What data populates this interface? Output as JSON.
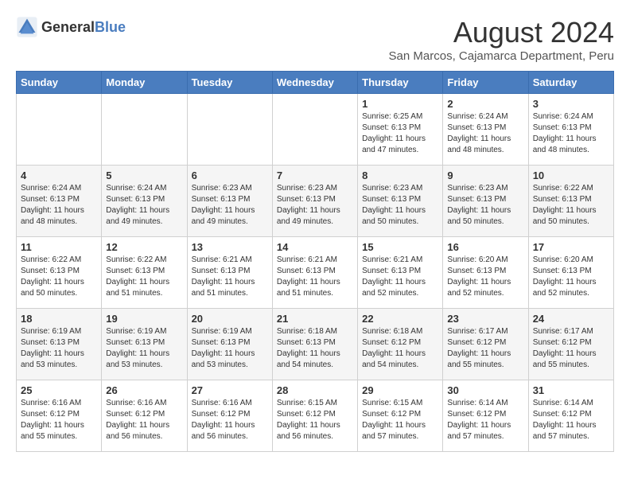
{
  "logo": {
    "general": "General",
    "blue": "Blue"
  },
  "title": "August 2024",
  "subtitle": "San Marcos, Cajamarca Department, Peru",
  "days_of_week": [
    "Sunday",
    "Monday",
    "Tuesday",
    "Wednesday",
    "Thursday",
    "Friday",
    "Saturday"
  ],
  "weeks": [
    [
      {
        "day": "",
        "content": ""
      },
      {
        "day": "",
        "content": ""
      },
      {
        "day": "",
        "content": ""
      },
      {
        "day": "",
        "content": ""
      },
      {
        "day": "1",
        "content": "Sunrise: 6:25 AM\nSunset: 6:13 PM\nDaylight: 11 hours and 47 minutes."
      },
      {
        "day": "2",
        "content": "Sunrise: 6:24 AM\nSunset: 6:13 PM\nDaylight: 11 hours and 48 minutes."
      },
      {
        "day": "3",
        "content": "Sunrise: 6:24 AM\nSunset: 6:13 PM\nDaylight: 11 hours and 48 minutes."
      }
    ],
    [
      {
        "day": "4",
        "content": "Sunrise: 6:24 AM\nSunset: 6:13 PM\nDaylight: 11 hours and 48 minutes."
      },
      {
        "day": "5",
        "content": "Sunrise: 6:24 AM\nSunset: 6:13 PM\nDaylight: 11 hours and 49 minutes."
      },
      {
        "day": "6",
        "content": "Sunrise: 6:23 AM\nSunset: 6:13 PM\nDaylight: 11 hours and 49 minutes."
      },
      {
        "day": "7",
        "content": "Sunrise: 6:23 AM\nSunset: 6:13 PM\nDaylight: 11 hours and 49 minutes."
      },
      {
        "day": "8",
        "content": "Sunrise: 6:23 AM\nSunset: 6:13 PM\nDaylight: 11 hours and 50 minutes."
      },
      {
        "day": "9",
        "content": "Sunrise: 6:23 AM\nSunset: 6:13 PM\nDaylight: 11 hours and 50 minutes."
      },
      {
        "day": "10",
        "content": "Sunrise: 6:22 AM\nSunset: 6:13 PM\nDaylight: 11 hours and 50 minutes."
      }
    ],
    [
      {
        "day": "11",
        "content": "Sunrise: 6:22 AM\nSunset: 6:13 PM\nDaylight: 11 hours and 50 minutes."
      },
      {
        "day": "12",
        "content": "Sunrise: 6:22 AM\nSunset: 6:13 PM\nDaylight: 11 hours and 51 minutes."
      },
      {
        "day": "13",
        "content": "Sunrise: 6:21 AM\nSunset: 6:13 PM\nDaylight: 11 hours and 51 minutes."
      },
      {
        "day": "14",
        "content": "Sunrise: 6:21 AM\nSunset: 6:13 PM\nDaylight: 11 hours and 51 minutes."
      },
      {
        "day": "15",
        "content": "Sunrise: 6:21 AM\nSunset: 6:13 PM\nDaylight: 11 hours and 52 minutes."
      },
      {
        "day": "16",
        "content": "Sunrise: 6:20 AM\nSunset: 6:13 PM\nDaylight: 11 hours and 52 minutes."
      },
      {
        "day": "17",
        "content": "Sunrise: 6:20 AM\nSunset: 6:13 PM\nDaylight: 11 hours and 52 minutes."
      }
    ],
    [
      {
        "day": "18",
        "content": "Sunrise: 6:19 AM\nSunset: 6:13 PM\nDaylight: 11 hours and 53 minutes."
      },
      {
        "day": "19",
        "content": "Sunrise: 6:19 AM\nSunset: 6:13 PM\nDaylight: 11 hours and 53 minutes."
      },
      {
        "day": "20",
        "content": "Sunrise: 6:19 AM\nSunset: 6:13 PM\nDaylight: 11 hours and 53 minutes."
      },
      {
        "day": "21",
        "content": "Sunrise: 6:18 AM\nSunset: 6:13 PM\nDaylight: 11 hours and 54 minutes."
      },
      {
        "day": "22",
        "content": "Sunrise: 6:18 AM\nSunset: 6:12 PM\nDaylight: 11 hours and 54 minutes."
      },
      {
        "day": "23",
        "content": "Sunrise: 6:17 AM\nSunset: 6:12 PM\nDaylight: 11 hours and 55 minutes."
      },
      {
        "day": "24",
        "content": "Sunrise: 6:17 AM\nSunset: 6:12 PM\nDaylight: 11 hours and 55 minutes."
      }
    ],
    [
      {
        "day": "25",
        "content": "Sunrise: 6:16 AM\nSunset: 6:12 PM\nDaylight: 11 hours and 55 minutes."
      },
      {
        "day": "26",
        "content": "Sunrise: 6:16 AM\nSunset: 6:12 PM\nDaylight: 11 hours and 56 minutes."
      },
      {
        "day": "27",
        "content": "Sunrise: 6:16 AM\nSunset: 6:12 PM\nDaylight: 11 hours and 56 minutes."
      },
      {
        "day": "28",
        "content": "Sunrise: 6:15 AM\nSunset: 6:12 PM\nDaylight: 11 hours and 56 minutes."
      },
      {
        "day": "29",
        "content": "Sunrise: 6:15 AM\nSunset: 6:12 PM\nDaylight: 11 hours and 57 minutes."
      },
      {
        "day": "30",
        "content": "Sunrise: 6:14 AM\nSunset: 6:12 PM\nDaylight: 11 hours and 57 minutes."
      },
      {
        "day": "31",
        "content": "Sunrise: 6:14 AM\nSunset: 6:12 PM\nDaylight: 11 hours and 57 minutes."
      }
    ]
  ]
}
